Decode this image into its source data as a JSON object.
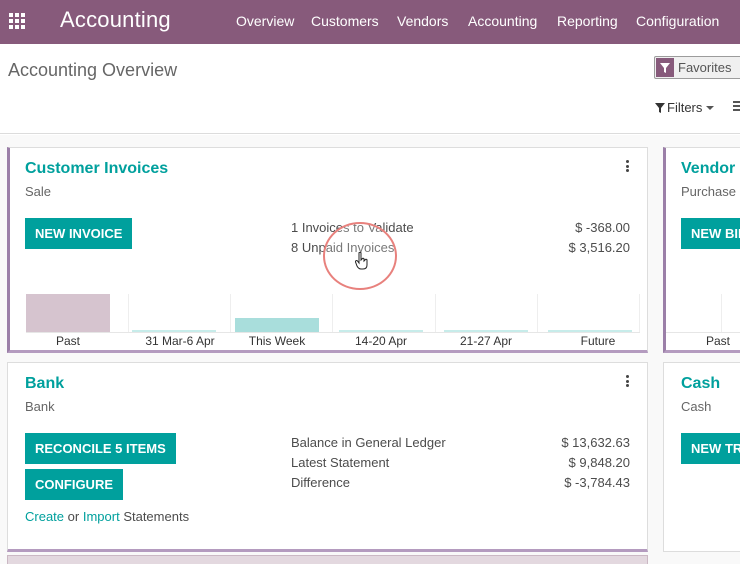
{
  "navbar": {
    "app_name": "Accounting",
    "menu": [
      "Overview",
      "Customers",
      "Vendors",
      "Accounting",
      "Reporting",
      "Configuration"
    ]
  },
  "control_panel": {
    "title": "Accounting Overview",
    "search_facet": "Favorites",
    "filters_label": "Filters"
  },
  "customer_invoices": {
    "title": "Customer Invoices",
    "subtitle": "Sale",
    "button": "NEW INVOICE",
    "stats": [
      {
        "label": "1 Invoices to Validate",
        "amount": "$ -368.00",
        "link": true
      },
      {
        "label": "8 Unpaid Invoices",
        "amount": "$ 3,516.20",
        "link": false
      }
    ],
    "chart_labels": [
      "Past",
      "31 Mar-6 Apr",
      "This Week",
      "14-20 Apr",
      "21-27 Apr",
      "Future"
    ]
  },
  "bank": {
    "title": "Bank",
    "subtitle": "Bank",
    "reconcile_button": "RECONCILE 5 ITEMS",
    "configure_button": "CONFIGURE",
    "create_text": "Create",
    "or_text": "or",
    "import_text": "Import",
    "statements_text": "Statements",
    "stats": [
      {
        "label": "Balance in General Ledger",
        "amount": "$ 13,632.63",
        "link": false
      },
      {
        "label": "Latest Statement",
        "amount": "$ 9,848.20",
        "link": false
      },
      {
        "label": "Difference",
        "amount": "$ -3,784.43",
        "link": true
      }
    ]
  },
  "vendor_bills": {
    "title": "Vendor Bills",
    "subtitle": "Purchase",
    "button": "NEW BILL",
    "chart_label": "Past"
  },
  "cash": {
    "title": "Cash",
    "subtitle": "Cash",
    "button": "NEW TRANSACTION"
  },
  "colors": {
    "brand": "#875a7b",
    "accent": "#00a09d",
    "past_bar": "#d6c4cf",
    "this_week_bar": "#a9dedc",
    "click_ring": "#e8817d"
  }
}
